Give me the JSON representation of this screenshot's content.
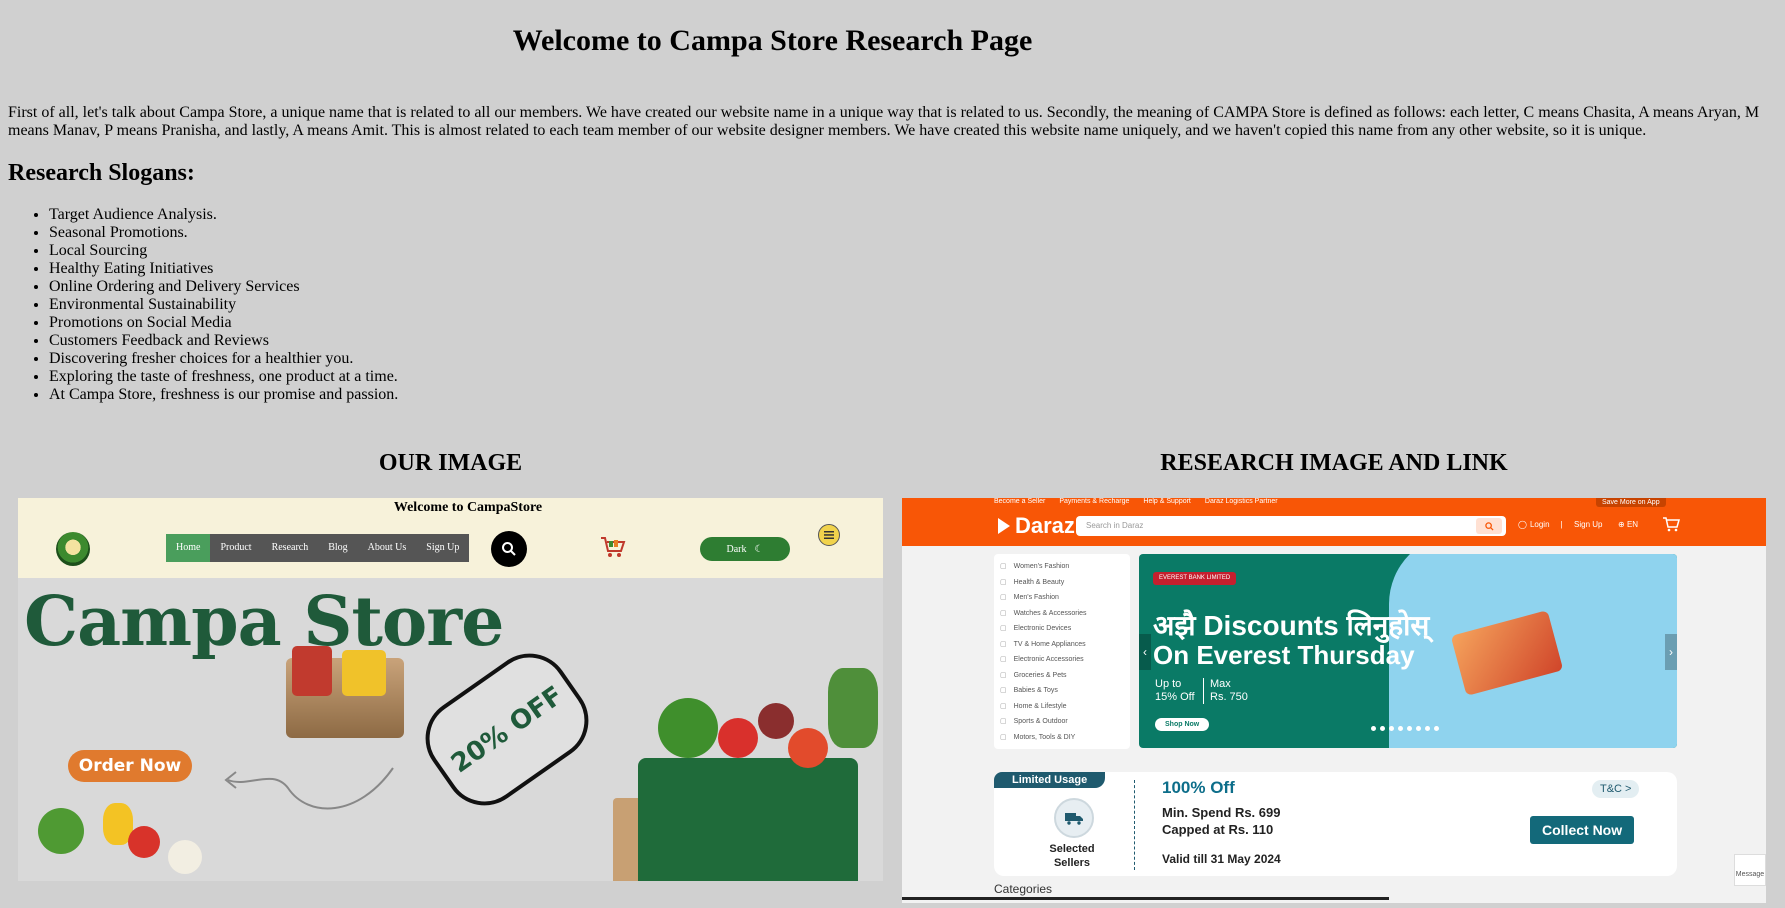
{
  "page": {
    "title": "Welcome to Campa Store Research Page",
    "intro": "First of all, let's talk about Campa Store, a unique name that is related to all our members. We have created our website name in a unique way that is related to us. Secondly, the meaning of CAMPA Store is defined as follows: each letter, C means Chasita, A means Aryan, M means Manav, P means Pranisha, and lastly, A means Amit. This is almost related to each team member of our website designer members. We have created this website name uniquely, and we haven't copied this name from any other website, so it is unique.",
    "slogans_title": "Research Slogans:",
    "slogans": [
      "Target Audience Analysis.",
      "Seasonal Promotions.",
      "Local Sourcing",
      "Healthy Eating Initiatives",
      "Online Ordering and Delivery Services",
      "Environmental Sustainability",
      "Promotions on Social Media",
      "Customers Feedback and Reviews",
      "Discovering fresher choices for a healthier you.",
      "Exploring the taste of freshness, one product at a time.",
      "At Campa Store, freshness is our promise and passion."
    ],
    "left_heading": "OUR IMAGE",
    "right_heading": "RESEARCH IMAGE AND LINK"
  },
  "campa": {
    "welcome": "Welcome to CampaStore",
    "nav": [
      "Home",
      "Product",
      "Research",
      "Blog",
      "About Us",
      "Sign Up"
    ],
    "dark_label": "Dark",
    "brand": "Campa Store",
    "order_button": "Order Now",
    "offer": "20% OFF",
    "colors": {
      "header_bg": "#f7f2da",
      "nav_active": "#4a9e5c",
      "brand_green": "#1f5a3a",
      "order_orange": "#e07a2e",
      "dark_toggle": "#2e7d32"
    }
  },
  "daraz": {
    "top_links": [
      "Become a Seller",
      "Payments & Recharge",
      "Help & Support",
      "Daraz Logistics Partner"
    ],
    "save_app": "Save More on App",
    "logo": "Daraz",
    "search_placeholder": "Search in Daraz",
    "login": "Login",
    "signup": "Sign Up",
    "language": "EN",
    "categories_menu": [
      "Women's Fashion",
      "Health & Beauty",
      "Men's Fashion",
      "Watches & Accessories",
      "Electronic Devices",
      "TV & Home Appliances",
      "Electronic Accessories",
      "Groceries & Pets",
      "Babies & Toys",
      "Home & Lifestyle",
      "Sports & Outdoor",
      "Motors, Tools & DIY"
    ],
    "banner": {
      "bank": "EVEREST BANK LIMITED",
      "line1": "अझै Discounts लिनुहोस्",
      "line2": "On Everest Thursday",
      "upto": "Up to",
      "upto_value": "15% Off",
      "max": "Max",
      "max_value": "Rs. 750",
      "shop": "Shop Now"
    },
    "voucher": {
      "tag": "Limited Usage",
      "seller": "Selected Sellers",
      "offer": "100% Off",
      "min": "Min. Spend Rs. 699",
      "cap": "Capped at Rs. 110",
      "valid": "Valid till 31 May 2024",
      "tc": "T&C >",
      "collect": "Collect Now"
    },
    "categories_heading": "Categories",
    "message": "Message",
    "colors": {
      "brand_orange": "#f85606",
      "banner_green": "#0a7a66",
      "collect_teal": "#13697a"
    }
  }
}
